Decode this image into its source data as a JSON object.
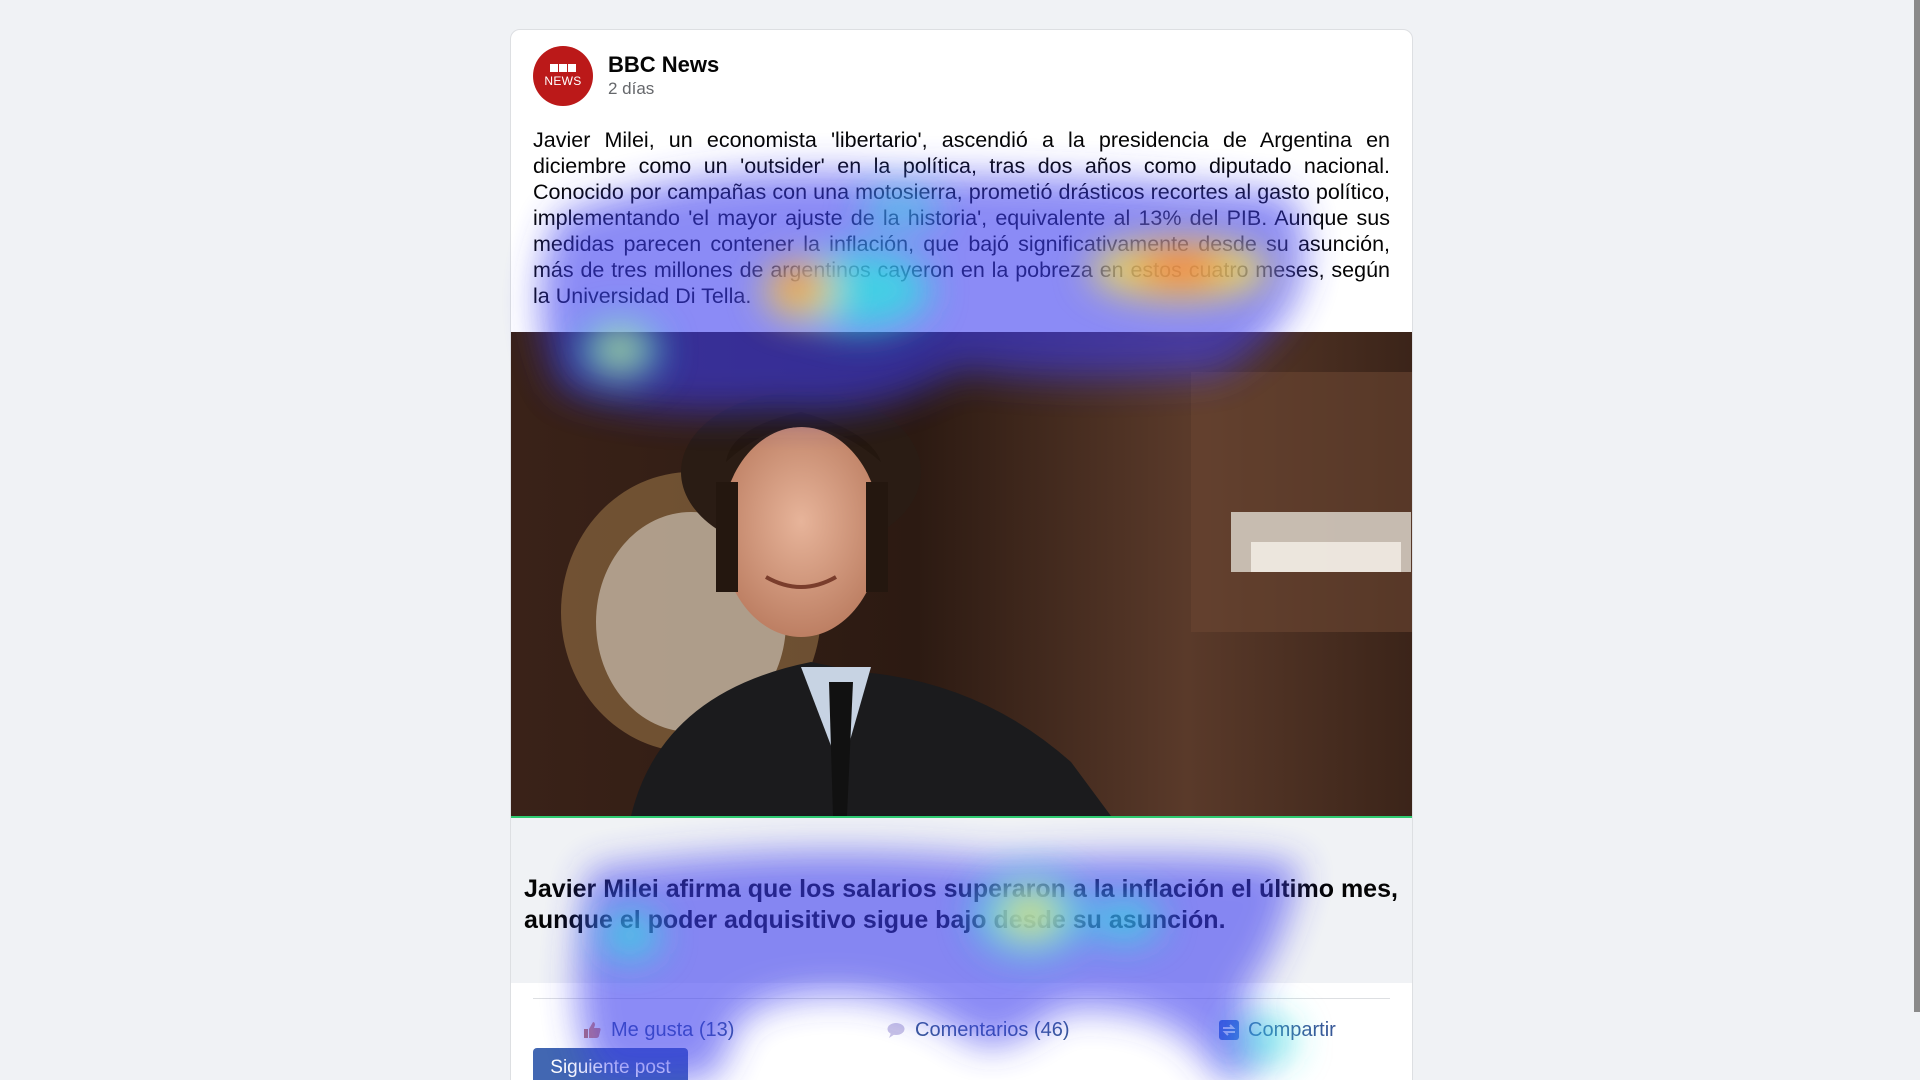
{
  "post": {
    "source": "BBC News",
    "time": "2 días",
    "logo_top": "BBC",
    "logo_bottom": "NEWS",
    "body": "Javier Milei, un economista 'libertario', ascendió a la presidencia de Argentina en diciembre como un 'outsider' en la política, tras dos años como diputado nacional. Conocido por campañas con una motosierra, prometió drásticos recortes al gasto político, implementando 'el mayor ajuste de la historia', equivalente al 13% del PIB. Aunque sus medidas parecen contener la inflación, que bajó significativamente desde su asunción, más de tres millones de argentinos cayeron en la pobreza en estos cuatro meses, según la Universidad Di Tella.",
    "headline": "Javier Milei afirma que los salarios superaron a la inflación el último mes, aunque el poder adquisitivo sigue bajo desde su asunción."
  },
  "actions": {
    "like": "Me gusta (13)",
    "comments": "Comentarios (46)",
    "share": "Compartir"
  },
  "next_button": "Siguiente post",
  "icons": {
    "like": "thumbs-up-icon",
    "comments": "speech-bubble-icon",
    "share": "share-icon"
  },
  "colors": {
    "brand_red": "#bb1919",
    "link_blue": "#385898",
    "button_blue": "#4267b2",
    "background": "#f0f2f5"
  }
}
